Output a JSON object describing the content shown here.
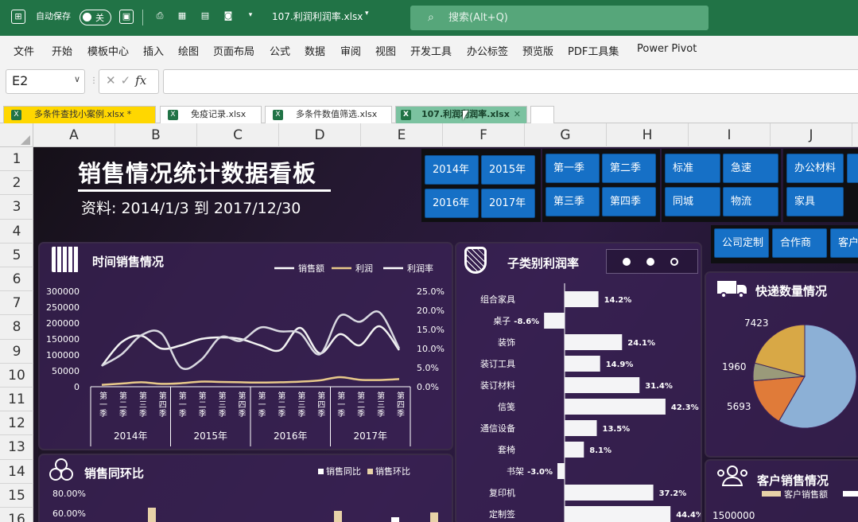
{
  "titlebar": {
    "autosave_label": "自动保存",
    "autosave_state": "关",
    "filename": "107.利润利润率.xlsx",
    "search_placeholder": "搜索(Alt+Q)"
  },
  "menu": [
    "文件",
    "开始",
    "模板中心",
    "插入",
    "绘图",
    "页面布局",
    "公式",
    "数据",
    "审阅",
    "视图",
    "开发工具",
    "办公标签",
    "预览版",
    "PDF工具集",
    "Power Pivot"
  ],
  "formula_bar": {
    "cell_ref": "E2",
    "fx_label": "fx",
    "value": ""
  },
  "tabs": [
    "多条件查找小案例.xlsx *",
    "免疫记录.xlsx",
    "多条件数值筛选.xlsx",
    "107.利润利润率.xlsx"
  ],
  "columns": [
    "A",
    "B",
    "C",
    "D",
    "E",
    "F",
    "G",
    "H",
    "I",
    "J"
  ],
  "rows": [
    "1",
    "2",
    "3",
    "4",
    "5",
    "6",
    "7",
    "8",
    "9",
    "10",
    "11",
    "12",
    "13",
    "14",
    "15",
    "16"
  ],
  "dashboard": {
    "title": "销售情况统计数据看板",
    "subtitle": "资料: 2014/1/3 到 2017/12/30",
    "slicers": {
      "years": [
        "2014年",
        "2015年",
        "2016年",
        "2017年"
      ],
      "quarters": [
        "第一季",
        "第二季",
        "第三季",
        "第四季"
      ],
      "shipping": [
        "标准",
        "急速",
        "同城",
        "物流"
      ],
      "category": [
        "办公材料",
        "家具"
      ],
      "customer": [
        "公司定制",
        "合作商",
        "客户"
      ]
    }
  },
  "panels": {
    "time_sales": "时间销售情况",
    "profit_rate": "子类别利润率",
    "yoy": "销售同环比",
    "express": "快递数量情况",
    "customer": "客户销售情况"
  },
  "chart_data": [
    {
      "type": "line",
      "title": "时间销售情况",
      "legend": [
        "销售额",
        "利润",
        "利润率"
      ],
      "years": [
        "2014年",
        "2015年",
        "2016年",
        "2017年"
      ],
      "categories": [
        "第一季",
        "第二季",
        "第三季",
        "第四季",
        "第一季",
        "第二季",
        "第三季",
        "第四季",
        "第一季",
        "第二季",
        "第三季",
        "第四季",
        "第一季",
        "第二季",
        "第三季",
        "第四季"
      ],
      "y_ticks": [
        "300000",
        "250000",
        "200000",
        "150000",
        "100000",
        "50000",
        "0"
      ],
      "y2_ticks": [
        "25.0%",
        "20.0%",
        "15.0%",
        "10.0%",
        "5.0%",
        "0.0%"
      ],
      "ylim": [
        0,
        300000
      ],
      "y2lim": [
        0,
        25
      ],
      "series": [
        {
          "name": "销售额",
          "values": [
            65000,
            140000,
            160000,
            120000,
            130000,
            150000,
            155000,
            150000,
            130000,
            115000,
            185000,
            105000,
            165000,
            130000,
            190000,
            115000
          ]
        },
        {
          "name": "利润",
          "values": [
            6000,
            10000,
            14000,
            9000,
            11000,
            16000,
            15000,
            14000,
            13000,
            14000,
            16000,
            20000,
            30000,
            22000,
            21000,
            24000
          ]
        },
        {
          "name": "利润率",
          "values": [
            5.5,
            8.5,
            13.5,
            14.0,
            5.0,
            7.0,
            13.0,
            12.0,
            15.5,
            14.5,
            14.0,
            8.5,
            18.5,
            17.0,
            19.5,
            10.0
          ]
        }
      ]
    },
    {
      "type": "bar",
      "title": "子类别利润率",
      "categories": [
        "组合家具",
        "桌子",
        "装饰",
        "装订工具",
        "装订材料",
        "信笺",
        "通信设备",
        "套椅",
        "书架",
        "复印机",
        "定制签"
      ],
      "values": [
        14.2,
        -8.6,
        24.1,
        14.9,
        31.4,
        42.3,
        13.5,
        8.1,
        -3.0,
        37.2,
        44.4
      ],
      "labels": [
        "14.2%",
        "-8.6%",
        "24.1%",
        "14.9%",
        "31.4%",
        "42.3%",
        "13.5%",
        "8.1%",
        "-3.0%",
        "37.2%",
        "44.4%"
      ]
    },
    {
      "type": "bar",
      "title": "销售同环比",
      "legend": [
        "销售同比",
        "销售环比"
      ],
      "y_ticks": [
        "80.00%",
        "60.00%"
      ]
    },
    {
      "type": "pie",
      "title": "快递数量情况",
      "labels": [
        "7423",
        "1960",
        "5693"
      ]
    },
    {
      "type": "bar",
      "title": "客户销售情况",
      "legend": [
        "客户销售额"
      ],
      "y_ticks": [
        "1500000"
      ]
    }
  ],
  "colors": {
    "excel_green": "#217346",
    "slicer_blue": "#1670c6",
    "panel_bg": "#3c2258",
    "tab_yellow": "#ffd700",
    "tab_green": "#7bc2a0",
    "pie_blue": "#8cb0d6",
    "pie_orange": "#e07b39",
    "pie_gray": "#9a9a9a",
    "pie_gold": "#d8a846"
  },
  "icons": [
    "excel-icon",
    "save-icon",
    "print-preview-icon",
    "calendar-icon",
    "basket-icon",
    "truck-icon",
    "users-icon",
    "rgb-icon",
    "search-icon",
    "camera-icon"
  ]
}
